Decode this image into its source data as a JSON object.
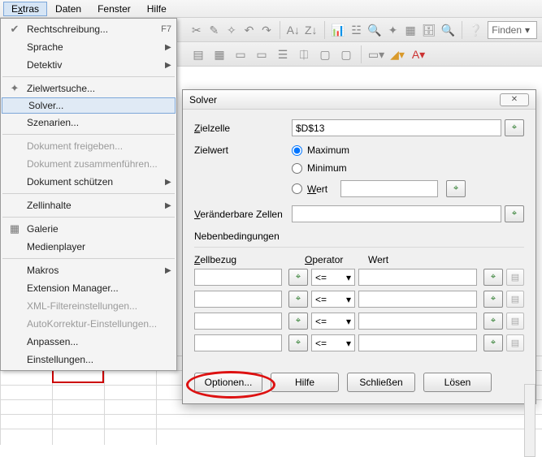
{
  "menubar": {
    "extras": "Extras",
    "daten": "Daten",
    "fenster": "Fenster",
    "hilfe": "Hilfe"
  },
  "toolbar": {
    "finden": "Finden"
  },
  "menu": {
    "rechtschreibung": "Rechtschreibung...",
    "rechtschreibung_key": "F7",
    "sprache": "Sprache",
    "detektiv": "Detektiv",
    "zielwertsuche": "Zielwertsuche...",
    "solver": "Solver...",
    "szenarien": "Szenarien...",
    "dok_freigeben": "Dokument freigeben...",
    "dok_zusammen": "Dokument zusammenführen...",
    "dok_schuetzen": "Dokument schützen",
    "zellinhalte": "Zellinhalte",
    "galerie": "Galerie",
    "medienplayer": "Medienplayer",
    "makros": "Makros",
    "extension": "Extension Manager...",
    "xml_filter": "XML-Filtereinstellungen...",
    "autokorrektur": "AutoKorrektur-Einstellungen...",
    "anpassen": "Anpassen...",
    "einstellungen": "Einstellungen..."
  },
  "solver": {
    "title": "Solver",
    "zielzelle": "Zielzelle",
    "zielzelle_value": "$D$13",
    "zielwert": "Zielwert",
    "maximum": "Maximum",
    "minimum": "Minimum",
    "wert": "Wert",
    "veraenderbare": "Veränderbare Zellen",
    "neben": "Nebenbedingungen",
    "zellbezug": "Zellbezug",
    "operator": "Operator",
    "wert_col": "Wert",
    "op_default": "<=",
    "btn_optionen": "Optionen...",
    "btn_hilfe": "Hilfe",
    "btn_schliessen": "Schließen",
    "btn_loesen": "Lösen"
  }
}
